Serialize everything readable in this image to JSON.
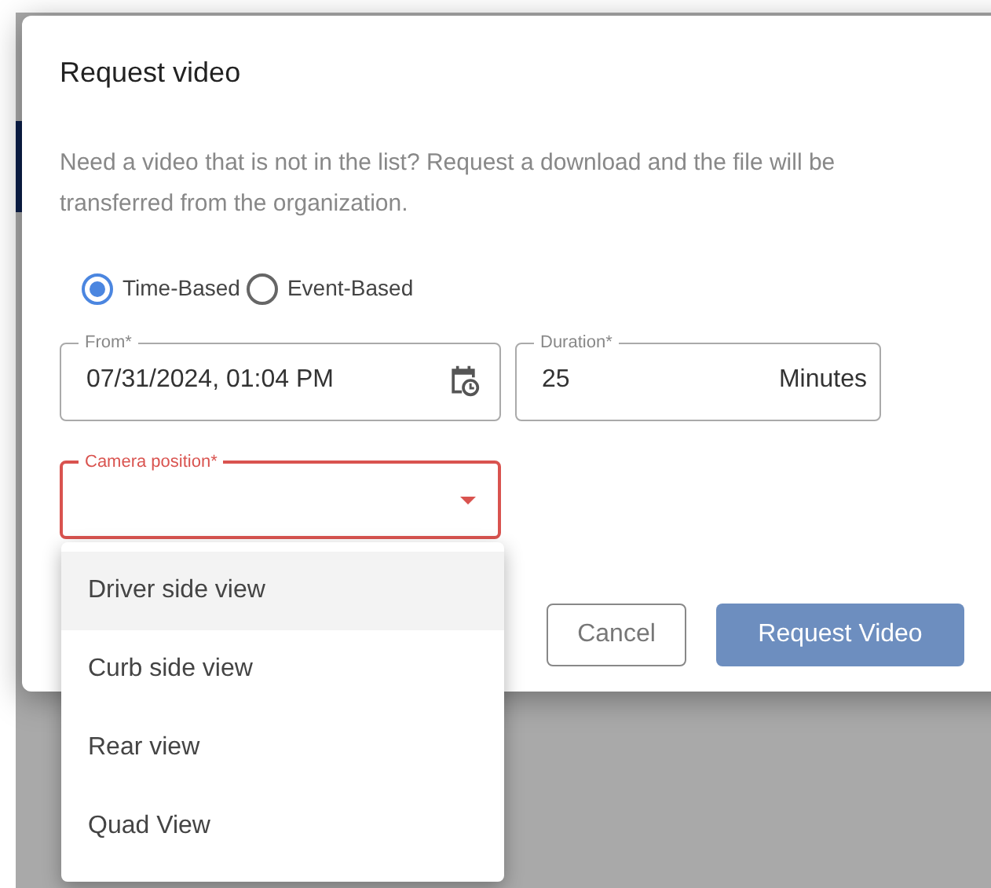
{
  "dialog": {
    "title": "Request video",
    "description": "Need a video that is not in the list? Request a download and the file will be transferred from the organization.",
    "request_type": [
      {
        "label": "Time-Based",
        "selected": true
      },
      {
        "label": "Event-Based",
        "selected": false
      }
    ],
    "from": {
      "label": "From*",
      "value": "07/31/2024, 01:04 PM"
    },
    "duration": {
      "label": "Duration*",
      "value": "25",
      "unit": "Minutes"
    },
    "camera_position": {
      "label": "Camera position*",
      "error": true,
      "expanded": true,
      "options": [
        {
          "label": "Driver side view",
          "highlighted": true
        },
        {
          "label": "Curb side view",
          "highlighted": false
        },
        {
          "label": "Rear view",
          "highlighted": false
        },
        {
          "label": "Quad View",
          "highlighted": false
        }
      ]
    },
    "buttons": [
      {
        "label": "Cancel",
        "kind": "outline"
      },
      {
        "label": "Request Video",
        "kind": "primary"
      }
    ]
  }
}
